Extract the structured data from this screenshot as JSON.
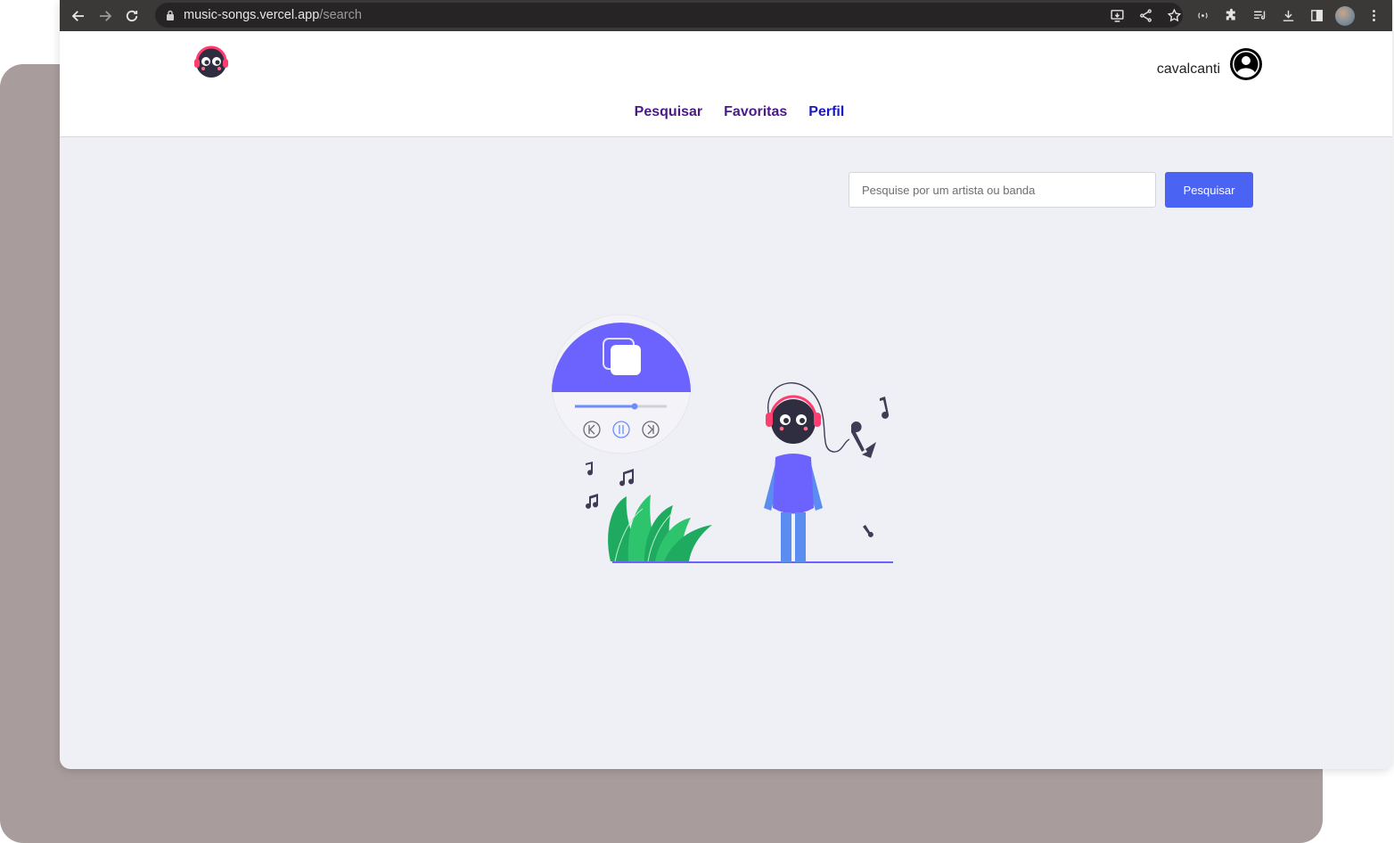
{
  "browser": {
    "url_host": "music-songs.vercel.app",
    "url_path": "/search",
    "icons": [
      "back-icon",
      "forward-icon",
      "reload-icon",
      "lock-icon",
      "install-icon",
      "share-icon",
      "star-icon",
      "extensions-icon",
      "media-icon",
      "download-icon",
      "sidepanel-icon",
      "profile-icon",
      "menu-icon"
    ]
  },
  "header": {
    "username": "cavalcanti",
    "nav": [
      {
        "label": "Pesquisar"
      },
      {
        "label": "Favoritas"
      },
      {
        "label": "Perfil"
      }
    ]
  },
  "search": {
    "placeholder": "Pesquise por um artista ou banda",
    "button_label": "Pesquisar"
  },
  "colors": {
    "accent": "#4b63f3",
    "illustration_purple": "#6c63ff",
    "nav_active": "#1a17c7",
    "nav_link": "#4a1a8a",
    "background": "#eff0f5"
  }
}
